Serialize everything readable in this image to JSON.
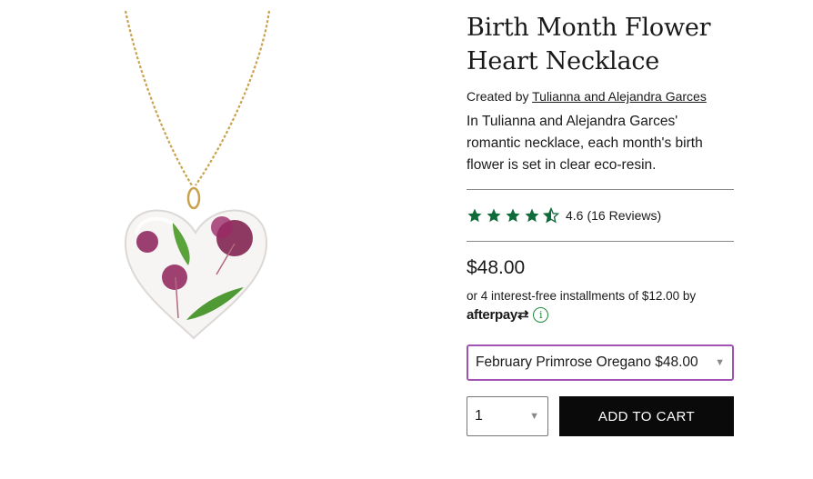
{
  "product": {
    "title": "Birth Month Flower Heart Necklace",
    "created_by_label": "Created by",
    "creator": "Tulianna and Alejandra Garces",
    "description": "In Tulianna and Alejandra Garces' romantic necklace, each month's birth flower is set in clear eco-resin.",
    "image_alt": "heart resin pendant necklace with pressed purple flowers"
  },
  "rating": {
    "value": "4.6",
    "reviews_label": "(16 Reviews)",
    "stars_full": 4,
    "stars_half": 1,
    "star_color": "#0f6b3a"
  },
  "pricing": {
    "price": "$48.00",
    "installments_text": "or 4 interest-free installments of $12.00 by",
    "afterpay_label": "afterpay",
    "afterpay_symbol": "⇄",
    "info_symbol": "i"
  },
  "variant": {
    "selected": "February Primrose Oregano $48.00",
    "border_color": "#a053b4"
  },
  "cart": {
    "quantity": "1",
    "add_label": "ADD TO CART"
  },
  "icons": {
    "caret": "▼"
  }
}
